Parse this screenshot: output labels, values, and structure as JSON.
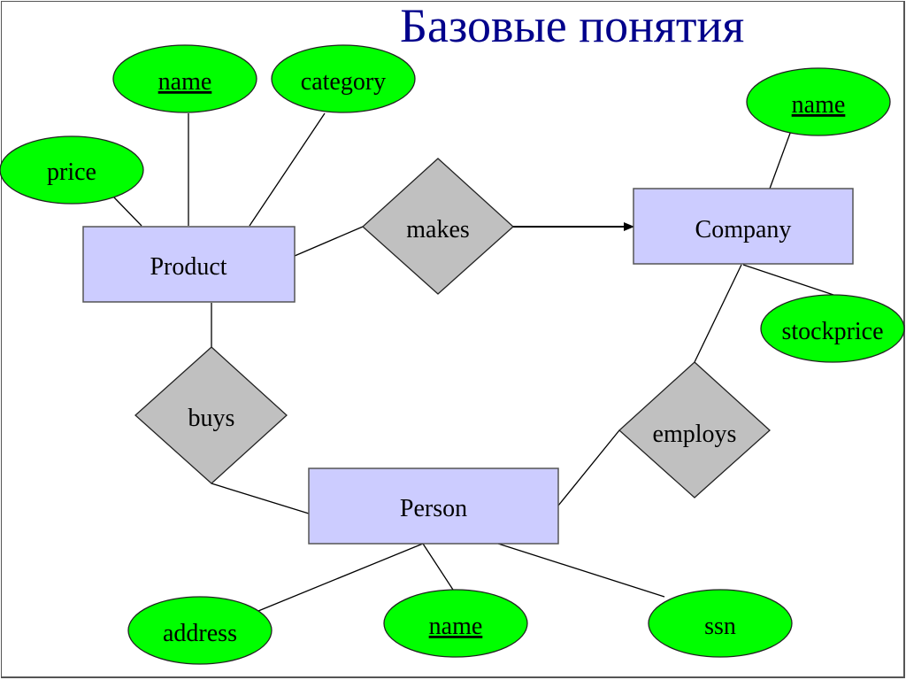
{
  "title": "Базовые понятия",
  "colors": {
    "title": "#00008b",
    "entity_fill": "#ccccff",
    "relationship_fill": "#c0c0c0",
    "attribute_fill": "#00ff00",
    "line": "#000000"
  },
  "entities": [
    {
      "id": "product",
      "label": "Product"
    },
    {
      "id": "company",
      "label": "Company"
    },
    {
      "id": "person",
      "label": "Person"
    }
  ],
  "relationships": [
    {
      "id": "makes",
      "label": "makes"
    },
    {
      "id": "buys",
      "label": "buys"
    },
    {
      "id": "employs",
      "label": "employs"
    }
  ],
  "attributes": [
    {
      "id": "product-name",
      "label": "name",
      "key": true,
      "owner": "product"
    },
    {
      "id": "product-category",
      "label": "category",
      "key": false,
      "owner": "product"
    },
    {
      "id": "product-price",
      "label": "price",
      "key": false,
      "owner": "product"
    },
    {
      "id": "company-name",
      "label": "name",
      "key": true,
      "owner": "company"
    },
    {
      "id": "company-stockprice",
      "label": "stockprice",
      "key": false,
      "owner": "company"
    },
    {
      "id": "person-address",
      "label": "address",
      "key": false,
      "owner": "person"
    },
    {
      "id": "person-name",
      "label": "name",
      "key": true,
      "owner": "person"
    },
    {
      "id": "person-ssn",
      "label": "ssn",
      "key": false,
      "owner": "person"
    }
  ],
  "connections": [
    {
      "from": "product",
      "to": "makes",
      "arrow": false
    },
    {
      "from": "makes",
      "to": "company",
      "arrow": true
    },
    {
      "from": "product",
      "to": "buys",
      "arrow": false
    },
    {
      "from": "buys",
      "to": "person",
      "arrow": false
    },
    {
      "from": "person",
      "to": "employs",
      "arrow": false
    },
    {
      "from": "employs",
      "to": "company",
      "arrow": false
    }
  ]
}
